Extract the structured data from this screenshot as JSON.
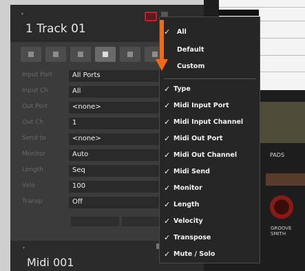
{
  "track": {
    "title": "1 Track 01",
    "rows": [
      {
        "label": "Input Port",
        "value": "All Ports"
      },
      {
        "label": "Input Ch",
        "value": "All"
      },
      {
        "label": "Out Port",
        "value": "<none>"
      },
      {
        "label": "Out Ch",
        "value": "1"
      },
      {
        "label": "Send to",
        "value": "<none>"
      },
      {
        "label": "Monitor",
        "value": "Auto"
      },
      {
        "label": "Length",
        "value": "Seq"
      },
      {
        "label": "Velo",
        "value": "100"
      },
      {
        "label": "Transp",
        "value": "Off"
      }
    ]
  },
  "footer": {
    "name": "Midi 001"
  },
  "right_panel": {
    "pads_label": "PADS",
    "knob_label": "GROOVE\nSMITH"
  },
  "menu": {
    "items": [
      {
        "label": "All",
        "checked": true
      },
      {
        "label": "Default",
        "checked": false
      },
      {
        "label": "Custom",
        "checked": false
      },
      {
        "label": "Type",
        "checked": true
      },
      {
        "label": "Midi Input Port",
        "checked": true
      },
      {
        "label": "Midi Input Channel",
        "checked": true
      },
      {
        "label": "Midi Out Port",
        "checked": true
      },
      {
        "label": "Midi Out Channel",
        "checked": true
      },
      {
        "label": "Midi Send",
        "checked": true
      },
      {
        "label": "Monitor",
        "checked": true
      },
      {
        "label": "Length",
        "checked": true
      },
      {
        "label": "Velocity",
        "checked": true
      },
      {
        "label": "Transpose",
        "checked": true
      },
      {
        "label": "Mute / Solo",
        "checked": true
      }
    ]
  },
  "colors": {
    "annotation_arrow": "#f06a1a",
    "record_accent": "#c81d2d"
  }
}
